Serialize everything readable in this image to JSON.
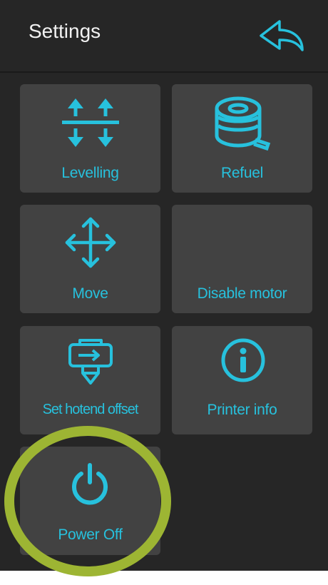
{
  "header": {
    "title": "Settings"
  },
  "tiles": {
    "levelling": {
      "label": "Levelling",
      "icon": "levelling-arrows-icon"
    },
    "refuel": {
      "label": "Refuel",
      "icon": "filament-spool-icon"
    },
    "move": {
      "label": "Move",
      "icon": "move-arrows-icon"
    },
    "disable_motor": {
      "label": "Disable motor",
      "icon": ""
    },
    "hotend_offset": {
      "label": "Set hotend offset",
      "icon": "hotend-icon"
    },
    "printer_info": {
      "label": "Printer info",
      "icon": "info-icon"
    },
    "power_off": {
      "label": "Power Off",
      "icon": "power-icon"
    }
  },
  "colors": {
    "background": "#262626",
    "tile": "#424242",
    "accent": "#27c1dd",
    "highlight": "#9db533",
    "title": "#f2f2f2"
  }
}
